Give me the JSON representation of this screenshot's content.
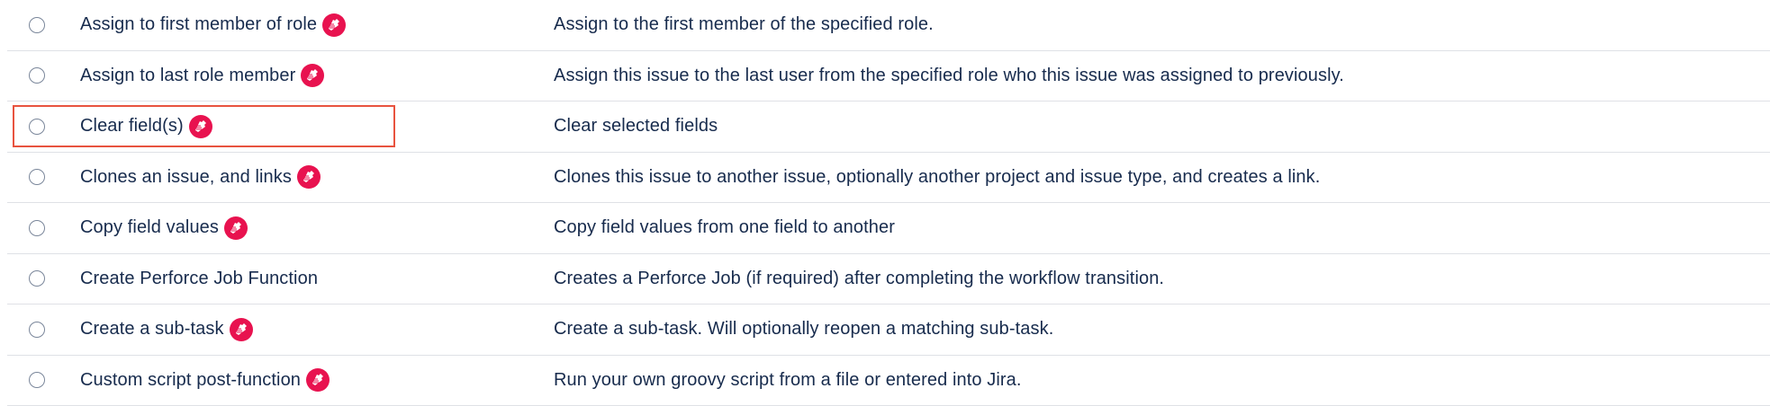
{
  "rows": [
    {
      "name": "Assign to first member of role",
      "badge": true,
      "description": "Assign to the first member of the specified role."
    },
    {
      "name": "Assign to last role member",
      "badge": true,
      "description": "Assign this issue to the last user from the specified role who this issue was assigned to previously."
    },
    {
      "name": "Clear field(s)",
      "badge": true,
      "description": "Clear selected fields",
      "highlighted": true
    },
    {
      "name": "Clones an issue, and links",
      "badge": true,
      "description": "Clones this issue to another issue, optionally another project and issue type, and creates a link."
    },
    {
      "name": "Copy field values",
      "badge": true,
      "description": "Copy field values from one field to another"
    },
    {
      "name": "Create Perforce Job Function",
      "badge": false,
      "description": "Creates a Perforce Job (if required) after completing the workflow transition."
    },
    {
      "name": "Create a sub-task",
      "badge": true,
      "description": "Create a sub-task. Will optionally reopen a matching sub-task."
    },
    {
      "name": "Custom script post-function",
      "badge": true,
      "description": "Run your own groovy script from a file or entered into Jira."
    }
  ],
  "colors": {
    "badge": "#e8124f",
    "highlight_border": "#e8533f",
    "divider": "#dfe1e6",
    "text": "#172b4d"
  },
  "icons": {
    "badge": "scriptrunner-icon",
    "radio": "radio-unselected"
  }
}
